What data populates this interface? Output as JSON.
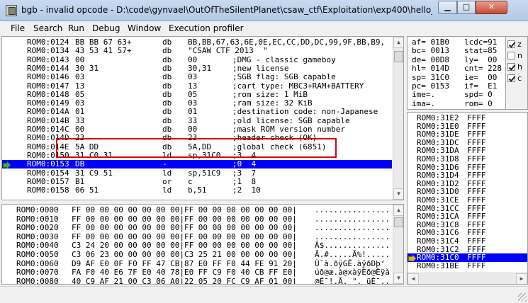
{
  "window": {
    "title": "bgb - invalid opcode - D:\\code\\gynvael\\OutOfTheSilentPlanet\\csaw_ctf\\Exploitation\\exp400\\hello_world - Copy...",
    "min_glyph": "▁",
    "max_glyph": "□",
    "close_glyph": "✕"
  },
  "menu": [
    "File",
    "Search",
    "Run",
    "Debug",
    "Window",
    "Execution profiler"
  ],
  "code": [
    {
      "addr": "ROM0:0124",
      "bytes": "BB BB 67 63+",
      "mn": "db",
      "ops": "BB,BB,67,63,6E,0E,EC,CC,DD,DC,99,9F,BB,B9,"
    },
    {
      "addr": "ROM0:0134",
      "bytes": "43 53 41 57+",
      "mn": "db",
      "ops": "\"CSAW CTF 2013  \""
    },
    {
      "addr": "ROM0:0143",
      "bytes": "00",
      "mn": "db",
      "ops": "00",
      "cmt": ";DMG - classic gameboy"
    },
    {
      "addr": "ROM0:0144",
      "bytes": "30 31",
      "mn": "db",
      "ops": "30,31",
      "cmt": ";new license"
    },
    {
      "addr": "ROM0:0146",
      "bytes": "03",
      "mn": "db",
      "ops": "03",
      "cmt": ";SGB flag: SGB capable"
    },
    {
      "addr": "ROM0:0147",
      "bytes": "13",
      "mn": "db",
      "ops": "13",
      "cmt": ";cart type: MBC3+RAM+BATTERY"
    },
    {
      "addr": "ROM0:0148",
      "bytes": "05",
      "mn": "db",
      "ops": "05",
      "cmt": ";rom size: 1 MiB"
    },
    {
      "addr": "ROM0:0149",
      "bytes": "03",
      "mn": "db",
      "ops": "03",
      "cmt": ";ram size: 32 KiB"
    },
    {
      "addr": "ROM0:014A",
      "bytes": "01",
      "mn": "db",
      "ops": "01",
      "cmt": ";destination code: non-Japanese"
    },
    {
      "addr": "ROM0:014B",
      "bytes": "33",
      "mn": "db",
      "ops": "33",
      "cmt": ";old license: SGB capable"
    },
    {
      "addr": "ROM0:014C",
      "bytes": "00",
      "mn": "db",
      "ops": "00",
      "cmt": ";mask ROM version number"
    },
    {
      "addr": "ROM0:014D",
      "bytes": "23",
      "mn": "db",
      "ops": "23",
      "cmt": ";header check (OK)"
    },
    {
      "addr": "ROM0:014E",
      "bytes": "5A DD",
      "mn": "db",
      "ops": "5A,DD",
      "cmt": ";global check (6851)"
    },
    {
      "addr": "ROM0:0150",
      "bytes": "31 C0 31",
      "mn": "ld",
      "ops": "sp,31C0",
      "cmt": ";3  4"
    },
    {
      "addr": "ROM0:0153",
      "bytes": "DB",
      "mn": "-",
      "ops": "",
      "cmt": ";0  4",
      "hl": true
    },
    {
      "addr": "ROM0:0154",
      "bytes": "31 C9 51",
      "mn": "ld",
      "ops": "sp,51C9",
      "cmt": ";3  7"
    },
    {
      "addr": "ROM0:0157",
      "bytes": "B1",
      "mn": "or",
      "ops": "c",
      "cmt": ";1  8"
    },
    {
      "addr": "ROM0:0158",
      "bytes": "06 51",
      "mn": "ld",
      "ops": "b,51",
      "cmt": ";2  10"
    }
  ],
  "memory": [
    {
      "addr": "ROM0:0000",
      "hex": "FF 00 00 00 00 00 00 00|FF 00 00 00 00 00 00 00|",
      "ascii": "................"
    },
    {
      "addr": "ROM0:0010",
      "hex": "FF 00 00 00 00 00 00 00|FF 00 00 00 00 00 00 00|",
      "ascii": "................"
    },
    {
      "addr": "ROM0:0020",
      "hex": "FF 00 00 00 00 00 00 00|FF 00 00 00 00 00 00 00|",
      "ascii": "................"
    },
    {
      "addr": "ROM0:0030",
      "hex": "FF 00 00 00 00 00 00 00|FF 00 00 00 00 00 00 00|",
      "ascii": "................"
    },
    {
      "addr": "ROM0:0040",
      "hex": "C3 24 20 00 00 00 00 00|FF 00 00 00 00 00 00 00|",
      "ascii": "Ã$.............."
    },
    {
      "addr": "ROM0:0050",
      "hex": "C3 06 23 00 00 00 00 00|C3 25 21 00 00 00 00 00|",
      "ascii": "Ã.#.....Ã%!....."
    },
    {
      "addr": "ROM0:0060",
      "hex": "D9 AF E0 0F F0 FF 47 CB|87 E0 FF F0 44 FE 91 20|",
      "ascii": "Ù¯à.ðÿGË.àÿðDþ‘ "
    },
    {
      "addr": "ROM0:0070",
      "hex": "FA F0 40 E6 7F E0 40 78|E0 FF C9 F0 40 CB FF E0|",
      "ascii": "úð@æ.à@xàÿÉð@Ëÿà"
    },
    {
      "addr": "ROM0:0080",
      "hex": "40 C9 AF 21 00 C3 06 A0|22 05 20 FC C9 AF 01 00|",
      "ascii": "@É¯!.Ã. \". üÉ¯.."
    }
  ],
  "registers": [
    {
      "l": "af= 01B0",
      "r": "lcdc=91"
    },
    {
      "l": "bc= 0013",
      "r": "stat=85"
    },
    {
      "l": "de= 00D8",
      "r": "ly=  00"
    },
    {
      "l": "hl= 014D",
      "r": "cnt= 228"
    },
    {
      "l": "sp= 31C0",
      "r": "ie=  00"
    },
    {
      "l": "pc= 0153",
      "r": "if=  E1"
    },
    {
      "l": "ime=.",
      "r": "spd= 0"
    },
    {
      "l": "ima=.",
      "r": "rom= 0"
    }
  ],
  "flags": [
    {
      "name": "z",
      "checked": true
    },
    {
      "name": "n",
      "checked": false
    },
    {
      "name": "h",
      "checked": true
    },
    {
      "name": "c",
      "checked": true
    }
  ],
  "stack": [
    {
      "addr": "ROM0:31E2",
      "val": "FFFF"
    },
    {
      "addr": "ROM0:31E0",
      "val": "FFFF"
    },
    {
      "addr": "ROM0:31DE",
      "val": "FFFF"
    },
    {
      "addr": "ROM0:31DC",
      "val": "FFFF"
    },
    {
      "addr": "ROM0:31DA",
      "val": "FFFF"
    },
    {
      "addr": "ROM0:31D8",
      "val": "FFFF"
    },
    {
      "addr": "ROM0:31D6",
      "val": "FFFF"
    },
    {
      "addr": "ROM0:31D4",
      "val": "FFFF"
    },
    {
      "addr": "ROM0:31D2",
      "val": "FFFF"
    },
    {
      "addr": "ROM0:31D0",
      "val": "FFFF"
    },
    {
      "addr": "ROM0:31CE",
      "val": "FFFF"
    },
    {
      "addr": "ROM0:31CC",
      "val": "FFFF"
    },
    {
      "addr": "ROM0:31CA",
      "val": "FFFF"
    },
    {
      "addr": "ROM0:31C8",
      "val": "FFFF"
    },
    {
      "addr": "ROM0:31C6",
      "val": "FFFF"
    },
    {
      "addr": "ROM0:31C4",
      "val": "FFFF"
    },
    {
      "addr": "ROM0:31C2",
      "val": "FFFF"
    },
    {
      "addr": "ROM0:31C0",
      "val": "FFFF",
      "hl": true
    },
    {
      "addr": "ROM0:31BE",
      "val": "FFFF"
    }
  ],
  "scroll_glyphs": {
    "up": "▲",
    "down": "▼",
    "left": "◀",
    "right": "▶"
  },
  "colors": {
    "highlight": "#0000ff",
    "annotation": "#e00000"
  }
}
